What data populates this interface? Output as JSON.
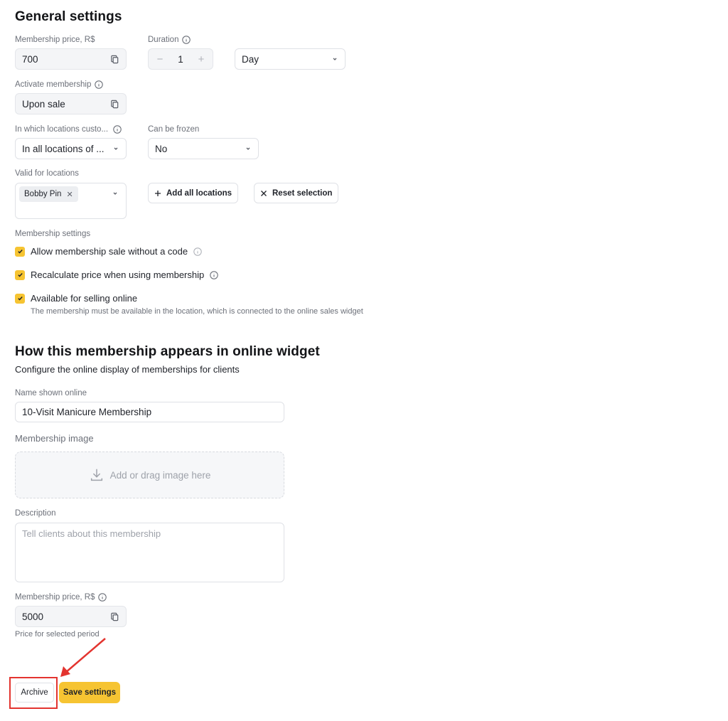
{
  "general": {
    "title": "General settings",
    "membership_price_label": "Membership price, R$",
    "membership_price_value": "700",
    "duration_label": "Duration",
    "duration_value": "1",
    "duration_unit": "Day",
    "activate_label": "Activate membership",
    "activate_value": "Upon sale",
    "locations_customers_label": "In which locations custo...",
    "locations_customers_value": "In all locations of ...",
    "can_be_frozen_label": "Can be frozen",
    "can_be_frozen_value": "No",
    "valid_locations_label": "Valid for locations",
    "valid_locations_chip": "Bobby Pin",
    "add_all_locations": "Add all locations",
    "reset_selection": "Reset selection"
  },
  "membership_settings": {
    "label": "Membership settings",
    "items": [
      {
        "label": "Allow membership sale without a code",
        "checked": true
      },
      {
        "label": "Recalculate price when using membership",
        "checked": true
      },
      {
        "label": "Available for selling online",
        "checked": true
      }
    ],
    "online_hint": "The membership must be available in the location, which is connected to the online sales widget"
  },
  "online": {
    "title": "How this membership appears in online widget",
    "subtitle": "Configure the online display of memberships for clients",
    "name_label": "Name shown online",
    "name_value": "10-Visit Manicure Membership",
    "image_label": "Membership image",
    "image_placeholder": "Add or drag image here",
    "description_label": "Description",
    "description_placeholder": "Tell clients about this membership",
    "price_label": "Membership price, R$",
    "price_value": "5000",
    "price_hint": "Price for selected period"
  },
  "actions": {
    "archive": "Archive",
    "save": "Save settings"
  },
  "colors": {
    "accent": "#f6c432",
    "annotation": "#e3342f"
  }
}
